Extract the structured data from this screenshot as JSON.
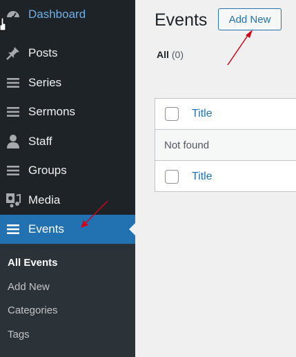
{
  "sidebar": {
    "items": [
      {
        "label": "Dashboard",
        "icon": "dashboard-icon"
      },
      {
        "label": "Posts",
        "icon": "pin-icon"
      },
      {
        "label": "Series",
        "icon": "list-icon"
      },
      {
        "label": "Sermons",
        "icon": "list-icon"
      },
      {
        "label": "Staff",
        "icon": "person-icon"
      },
      {
        "label": "Groups",
        "icon": "list-icon"
      },
      {
        "label": "Media",
        "icon": "media-icon"
      },
      {
        "label": "Events",
        "icon": "list-icon"
      }
    ],
    "submenu": [
      "All Events",
      "Add New",
      "Categories",
      "Tags"
    ]
  },
  "header": {
    "title": "Events",
    "add_new_label": "Add New"
  },
  "filters": {
    "all_label": "All",
    "all_count": "(0)"
  },
  "table": {
    "column_title": "Title",
    "empty_text": "Not found",
    "footer_title": "Title"
  },
  "colors": {
    "sidebar_bg": "#1d2327",
    "active_bg": "#2271b1",
    "link": "#2271b1",
    "annotation_arrow": "#d0021b"
  }
}
